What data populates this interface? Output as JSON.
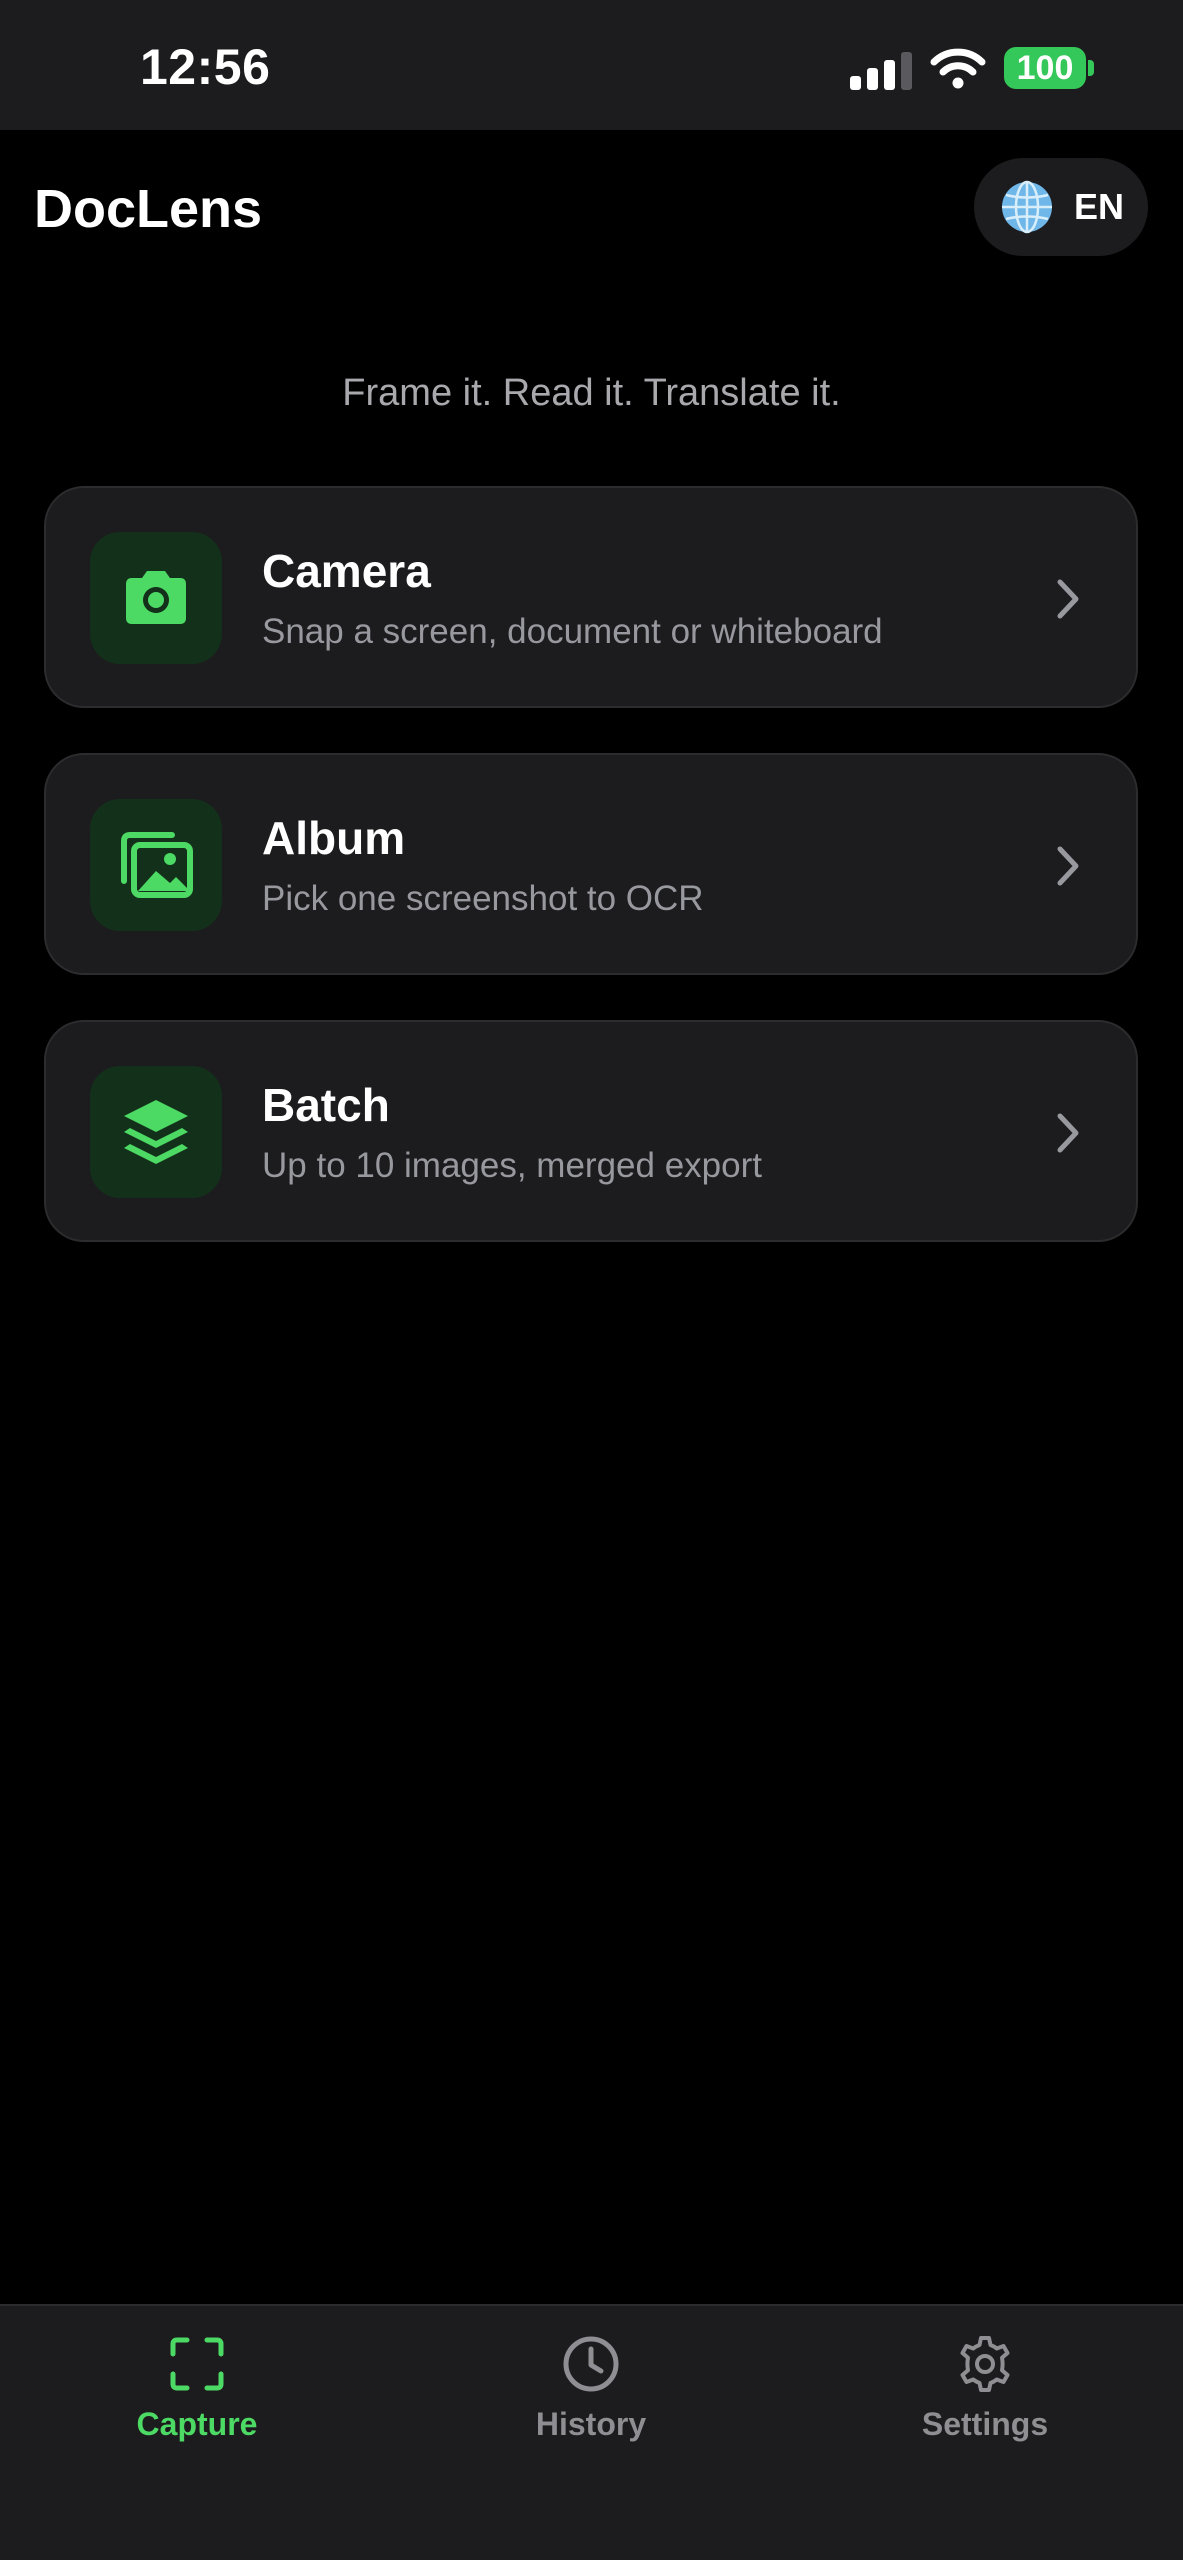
{
  "status_bar": {
    "time": "12:56",
    "battery": "100",
    "icons": [
      "signal-icon",
      "wifi-icon",
      "battery-icon"
    ]
  },
  "header": {
    "title": "DocLens",
    "language_button": {
      "icon": "globe-icon",
      "label": "EN"
    }
  },
  "tagline": "Frame it. Read it. Translate it.",
  "options": [
    {
      "icon": "camera-icon",
      "title": "Camera",
      "subtitle": "Snap a screen, document or whiteboard"
    },
    {
      "icon": "images-icon",
      "title": "Album",
      "subtitle": "Pick one screenshot to OCR"
    },
    {
      "icon": "layers-icon",
      "title": "Batch",
      "subtitle": "Up to 10 images, merged export"
    }
  ],
  "tabs": [
    {
      "icon": "scan-frame-icon",
      "label": "Capture",
      "active": true
    },
    {
      "icon": "clock-icon",
      "label": "History",
      "active": false
    },
    {
      "icon": "gear-icon",
      "label": "Settings",
      "active": false
    }
  ],
  "colors": {
    "accent": "#4cd964",
    "background": "#000000",
    "surface": "#1c1c1e",
    "icon_tile": "#13301a",
    "inactive_tab": "#8e8e93",
    "battery": "#34c759"
  }
}
